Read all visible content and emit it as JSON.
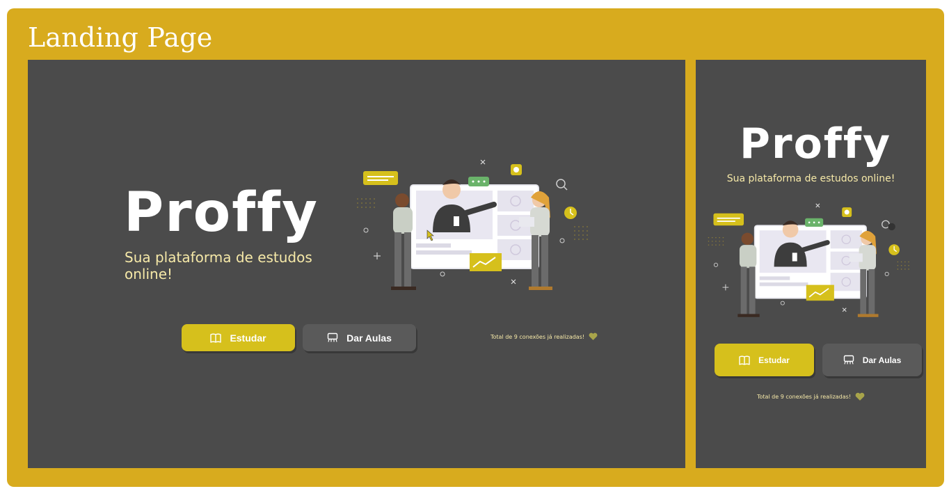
{
  "frame_title": "Landing Page",
  "desktop": {
    "logo": "Proffy",
    "tagline": "Sua plataforma de estudos online!",
    "study_label": "Estudar",
    "teach_label": "Dar Aulas",
    "connections": "Total de 9 conexões já realizadas!"
  },
  "mobile": {
    "logo": "Proffy",
    "tagline": "Sua plataforma de estudos online!",
    "study_label": "Estudar",
    "teach_label": "Dar Aulas",
    "connections": "Total de 9 conexões já realizadas!"
  },
  "colors": {
    "frame": "#d8ab1e",
    "panel": "#4b4b4b",
    "accent_yellow": "#d6c01c",
    "tagline": "#f6e9a8",
    "button_gray": "#5a5a5a"
  },
  "icons": [
    "book-icon",
    "presentation-icon",
    "heart-icon"
  ]
}
